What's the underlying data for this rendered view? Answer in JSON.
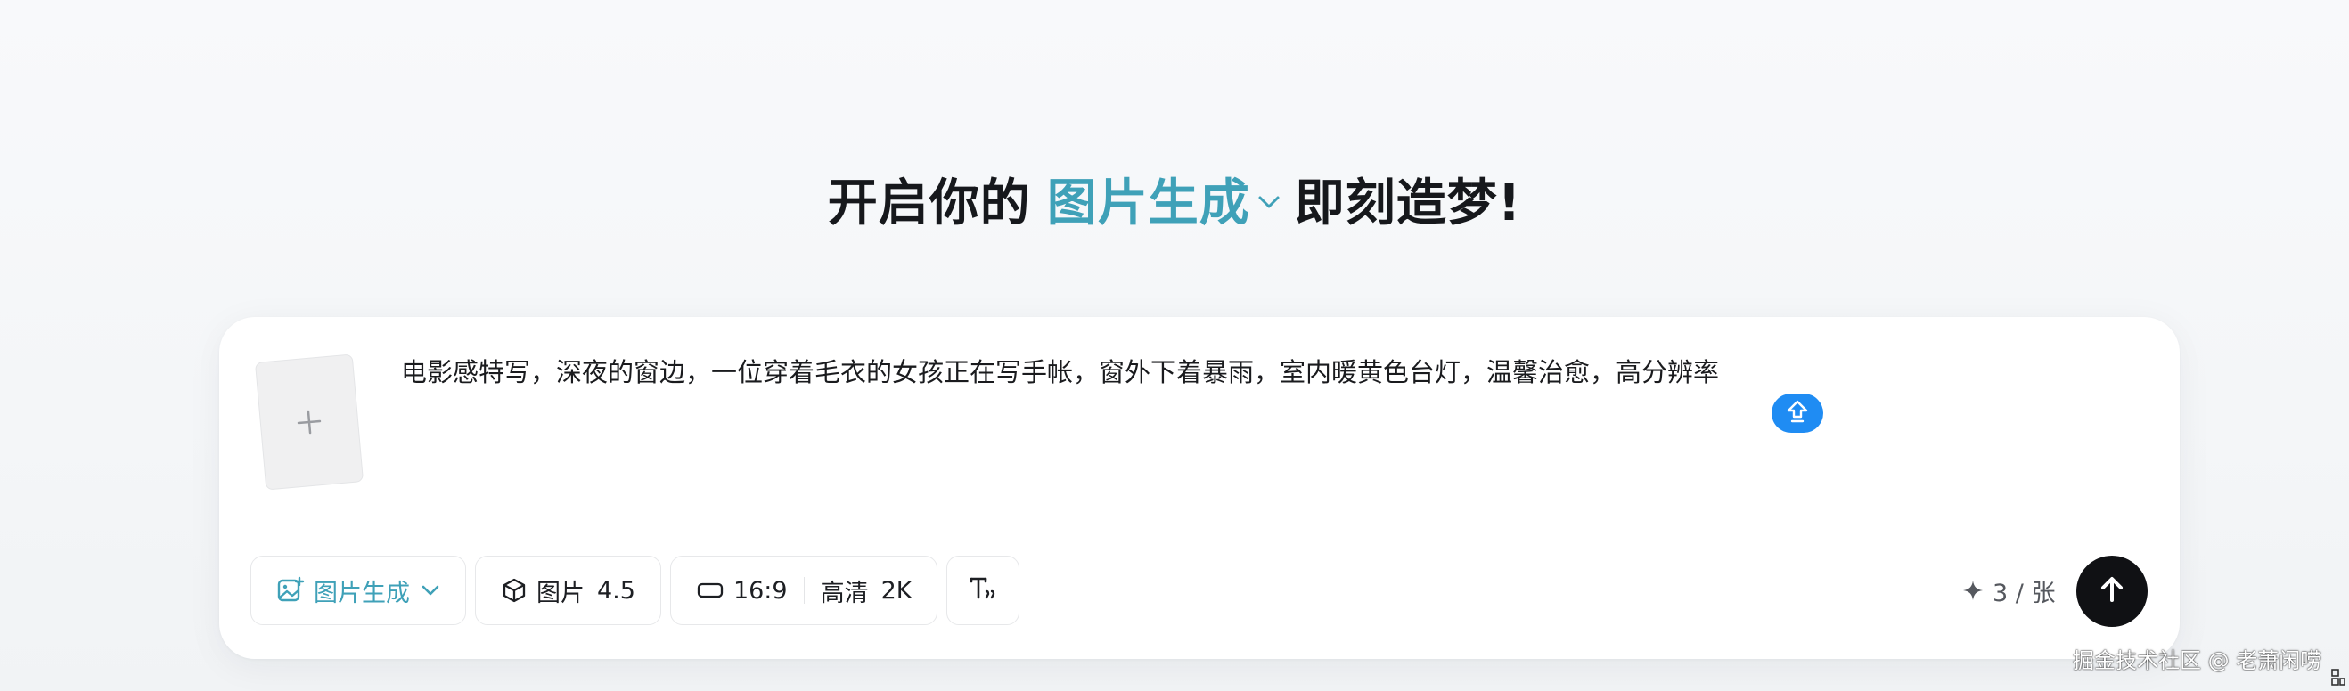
{
  "heading": {
    "prefix": "开启你的",
    "mode": "图片生成",
    "suffix": "即刻造梦!"
  },
  "prompt": {
    "text": "电影感特写，深夜的窗边，一位穿着毛衣的女孩正在写手帐，窗外下着暴雨，室内暖黄色台灯，温馨治愈，高分辨率"
  },
  "toolbar": {
    "mode_label": "图片生成",
    "model_label": "图片",
    "model_version": "4.5",
    "ratio": "16:9",
    "quality_label": "高清",
    "resolution": "2K"
  },
  "quota": {
    "text": "3 / 张"
  },
  "watermark": {
    "text": "掘金技术社区 @ 老萧闲唠"
  },
  "colors": {
    "accent": "#3fa1b8",
    "floating_button": "#1f8cf3",
    "send_button": "#101114",
    "background": "#f6f7f9",
    "card": "#ffffff"
  },
  "icons": {
    "mode_dropdown": "chevron-down-icon",
    "upload": "plus-icon",
    "floating": "upload-arrow-icon",
    "mode_chip": "image-plus-icon",
    "model_chip": "cube-icon",
    "ratio_chip": "rectangle-icon",
    "text_chip": "text-style-icon",
    "quota": "sparkle-icon",
    "send": "arrow-up-icon"
  }
}
